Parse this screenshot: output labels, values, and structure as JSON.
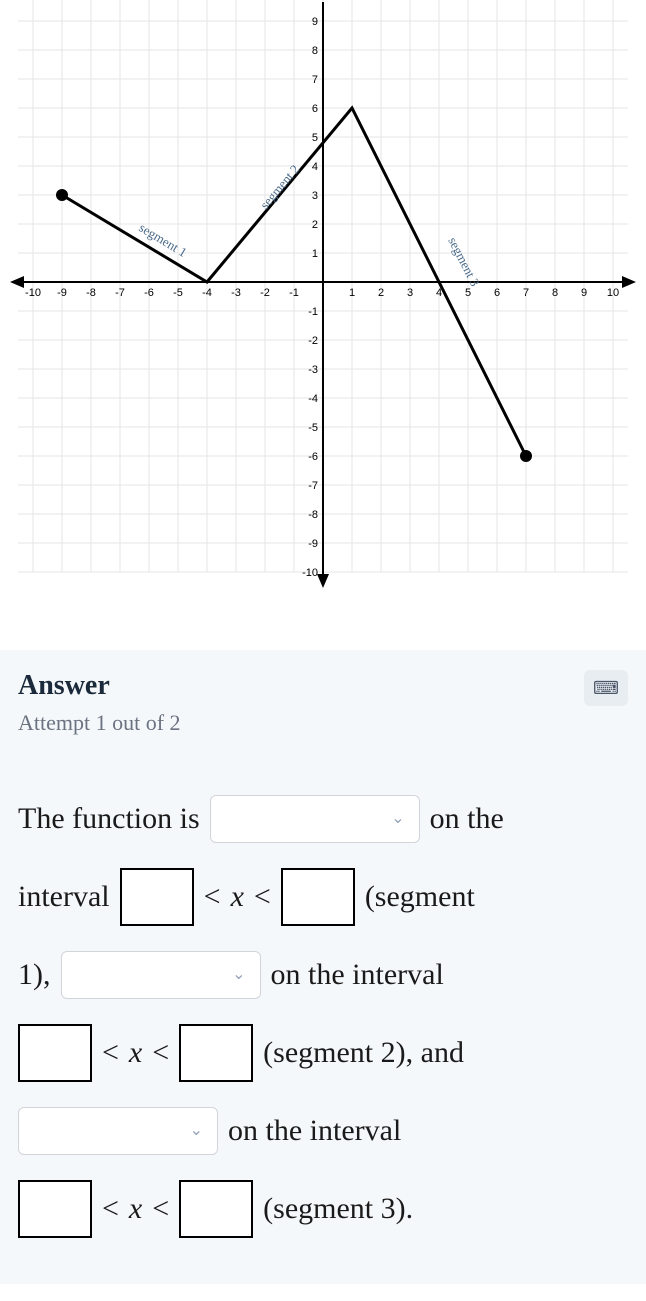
{
  "chart_data": {
    "type": "line",
    "xlim": [
      -10,
      10
    ],
    "ylim": [
      -10,
      9
    ],
    "xticks": [
      -10,
      -9,
      -8,
      -7,
      -6,
      -5,
      -4,
      -3,
      -2,
      -1,
      1,
      2,
      3,
      4,
      5,
      6,
      7,
      8,
      9,
      10
    ],
    "yticks": [
      -10,
      -9,
      -8,
      -7,
      -6,
      -5,
      -4,
      -3,
      -2,
      -1,
      1,
      2,
      3,
      4,
      5,
      6,
      7,
      8,
      9
    ],
    "segments": [
      {
        "name": "segment 1",
        "points": [
          [
            -9,
            3
          ],
          [
            -4,
            0
          ]
        ]
      },
      {
        "name": "segment 2",
        "points": [
          [
            -4,
            0
          ],
          [
            1,
            6
          ]
        ]
      },
      {
        "name": "segment 3",
        "points": [
          [
            1,
            6
          ],
          [
            7,
            -6
          ]
        ]
      }
    ],
    "endpoints": [
      [
        -9,
        3
      ],
      [
        7,
        -6
      ]
    ]
  },
  "answer": {
    "title": "Answer",
    "attempt": "Attempt 1 out of 2",
    "text": {
      "the_function_is": "The function is",
      "on_the": "on the",
      "interval": "interval",
      "lt_x_lt": "< x <",
      "segment1_label": "(segment",
      "one_comma": "1),",
      "on_the_interval": "on the interval",
      "segment2_label": "(segment 2), and",
      "segment3_label": "(segment 3)."
    },
    "var": "x"
  },
  "icons": {
    "keyboard": "⌨",
    "chevron": "⌄"
  }
}
